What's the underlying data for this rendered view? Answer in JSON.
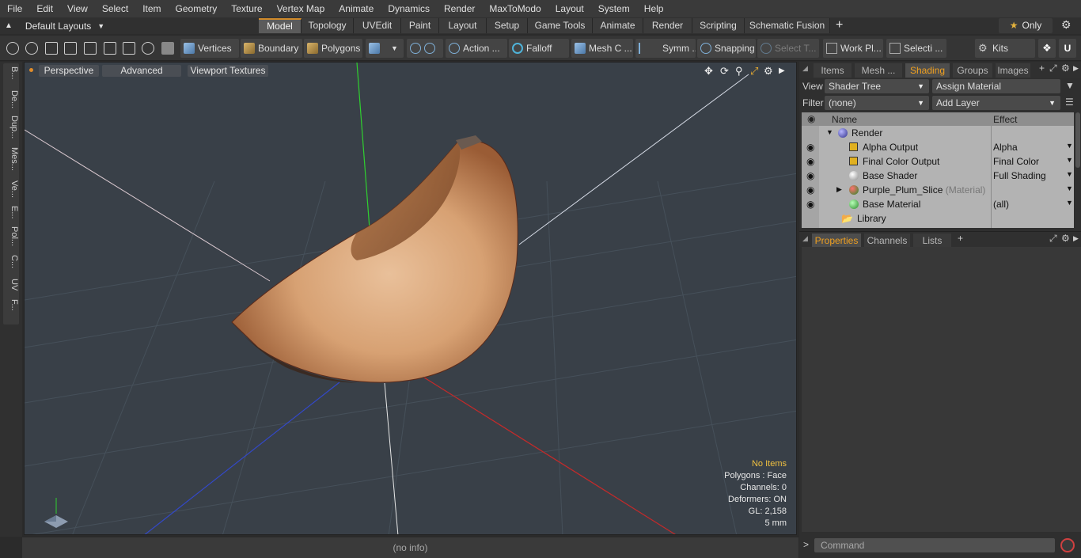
{
  "menu": [
    "File",
    "Edit",
    "View",
    "Select",
    "Item",
    "Geometry",
    "Texture",
    "Vertex Map",
    "Animate",
    "Dynamics",
    "Render",
    "MaxToModo",
    "Layout",
    "System",
    "Help"
  ],
  "layouts": {
    "label": "Default Layouts"
  },
  "tabs": [
    "Model",
    "Topology",
    "UVEdit",
    "Paint",
    "Layout",
    "Setup",
    "Game Tools",
    "Animate",
    "Render",
    "Scripting",
    "Schematic Fusion"
  ],
  "active_tab": "Model",
  "only_label": "Only",
  "toolbar": {
    "vertices": "Vertices",
    "boundary": "Boundary",
    "polygons": "Polygons",
    "action": "Action ...",
    "falloff": "Falloff",
    "mesh_c": "Mesh C ...",
    "symm": "Symm ...",
    "snapping": "Snapping",
    "select_t": "Select T...",
    "work_pl": "Work Pl...",
    "selecti": "Selecti ...",
    "kits": "Kits"
  },
  "left_tabs": [
    "B...",
    "De...",
    "Dup...",
    "Mes...",
    "Ve...",
    "E...",
    "Pol...",
    "C...",
    "UV",
    "F..."
  ],
  "viewport": {
    "perspective": "Perspective",
    "advanced": "Advanced",
    "textures": "Viewport Textures",
    "info": {
      "no_items": "No Items",
      "polygons": "Polygons : Face",
      "channels": "Channels: 0",
      "deformers": "Deformers: ON",
      "gl": "GL: 2,158",
      "scale": "5 mm"
    }
  },
  "status": {
    "no_info": "(no info)"
  },
  "right_tabs": [
    "Items",
    "Mesh ...",
    "Shading",
    "Groups",
    "Images"
  ],
  "right_active": "Shading",
  "shading": {
    "view_label": "View",
    "view_value": "Shader Tree",
    "assign_material": "Assign Material",
    "filter_label": "Filter",
    "filter_value": "(none)",
    "add_layer": "Add Layer",
    "col_name": "Name",
    "col_effect": "Effect",
    "rows": [
      {
        "name": "Render",
        "effect": "",
        "suffix": ""
      },
      {
        "name": "Alpha Output",
        "effect": "Alpha",
        "suffix": ""
      },
      {
        "name": "Final Color Output",
        "effect": "Final Color",
        "suffix": ""
      },
      {
        "name": "Base Shader",
        "effect": "Full Shading",
        "suffix": ""
      },
      {
        "name": "Purple_Plum_Slice",
        "effect": "",
        "suffix": "(Material)"
      },
      {
        "name": "Base Material",
        "effect": "(all)",
        "suffix": ""
      },
      {
        "name": "Library",
        "effect": "",
        "suffix": ""
      }
    ]
  },
  "props_tabs": [
    "Properties",
    "Channels",
    "Lists"
  ],
  "props_active": "Properties",
  "command": {
    "placeholder": "Command"
  },
  "colors": {
    "accent": "#d08a2a",
    "highlight": "#f0a020",
    "viewport_bg": "#394048"
  }
}
